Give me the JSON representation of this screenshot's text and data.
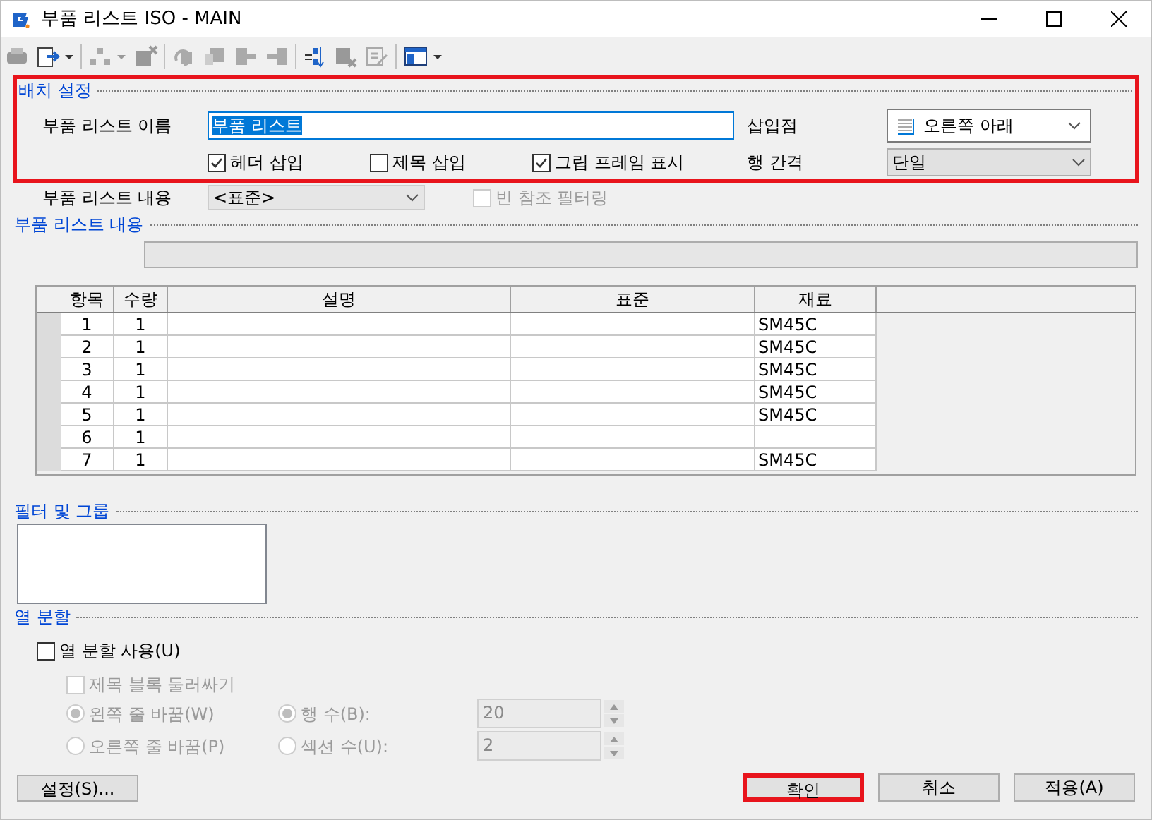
{
  "window": {
    "title": "부품 리스트 ISO - MAIN"
  },
  "placement": {
    "heading": "배치 설정",
    "highlighted": true,
    "name_label": "부품 리스트 이름",
    "name_value": "부품 리스트",
    "insert_label": "삽입점",
    "insert_value": "오른쪽 아래",
    "spacing_label": "행 간격",
    "spacing_value": "단일",
    "checkboxes": [
      {
        "label": "헤더 삽입",
        "checked": true
      },
      {
        "label": "제목 삽입",
        "checked": false
      },
      {
        "label": "그립 프레임 표시",
        "checked": true
      }
    ]
  },
  "content_row": {
    "label": "부품 리스트 내용",
    "value": "<표준>",
    "filter_label": "빈 참조 필터링",
    "filter_checked": false,
    "filter_disabled": true
  },
  "content": {
    "heading": "부품 리스트 내용"
  },
  "table": {
    "columns": [
      "항목",
      "수량",
      "설명",
      "표준",
      "재료"
    ],
    "rows": [
      [
        "1",
        "1",
        "",
        "",
        "SM45C"
      ],
      [
        "2",
        "1",
        "",
        "",
        "SM45C"
      ],
      [
        "3",
        "1",
        "",
        "",
        "SM45C"
      ],
      [
        "4",
        "1",
        "",
        "",
        "SM45C"
      ],
      [
        "5",
        "1",
        "",
        "",
        "SM45C"
      ],
      [
        "6",
        "1",
        "",
        "",
        ""
      ],
      [
        "7",
        "1",
        "",
        "",
        "SM45C"
      ]
    ]
  },
  "filter": {
    "heading": "필터 및 그룹"
  },
  "split": {
    "heading": "열 분할",
    "use_label": "열 분할 사용(U)",
    "use_checked": false,
    "wrap_label": "제목 블록 둘러싸기",
    "wrap_checked": false,
    "disabled": true,
    "wrap_radios": [
      {
        "label": "왼쪽 줄 바꿈(W)",
        "selected": true
      },
      {
        "label": "오른쪽 줄 바꿈(P)",
        "selected": false
      }
    ],
    "count_radios": [
      {
        "label": "행 수(B):",
        "selected": true,
        "value": "20"
      },
      {
        "label": "섹션 수(U):",
        "selected": false,
        "value": "2"
      }
    ]
  },
  "settings_button": "설정(S)...",
  "buttons": [
    {
      "label": "확인",
      "highlighted": true
    },
    {
      "label": "취소",
      "highlighted": false
    },
    {
      "label": "적용(A)",
      "highlighted": false
    }
  ]
}
